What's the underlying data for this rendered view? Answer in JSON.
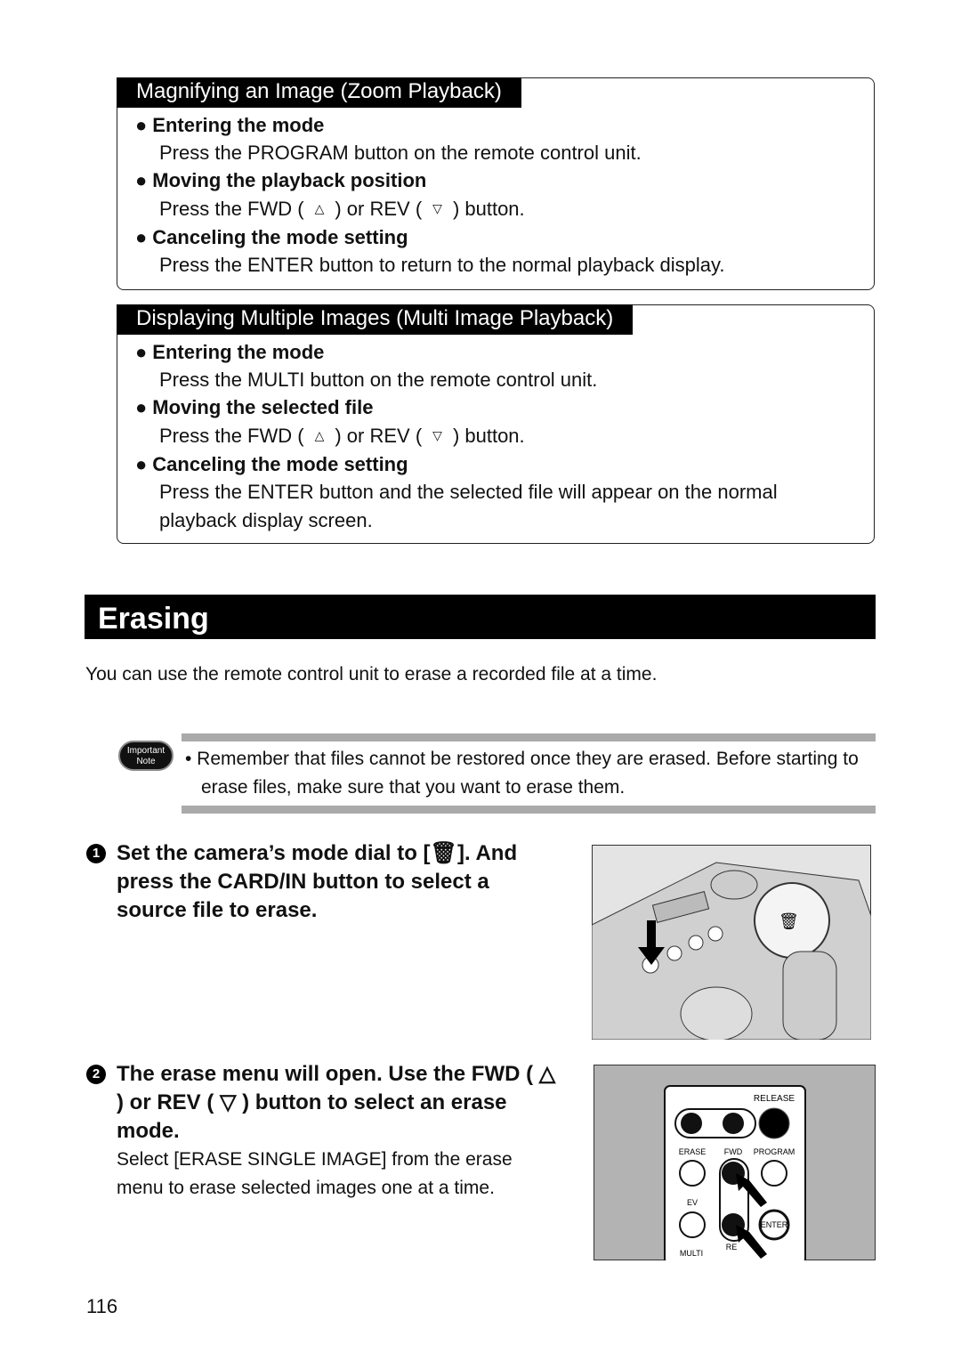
{
  "zoom_box": {
    "title": "Magnifying an Image (Zoom Playback)",
    "items": [
      {
        "heading": "Entering the mode",
        "body": "Press the PROGRAM button on the remote control unit."
      },
      {
        "heading": "Moving the playback position",
        "body_pre": "Press the FWD (",
        "fwd_symbol": "△",
        "body_mid": ") or REV (",
        "rev_symbol": "▽",
        "body_post": ") button."
      },
      {
        "heading": "Canceling the mode setting",
        "body": "Press the ENTER button to return to the normal playback display."
      }
    ]
  },
  "multi_box": {
    "title": "Displaying Multiple Images (Multi Image Playback)",
    "items": [
      {
        "heading": "Entering the mode",
        "body": "Press the MULTI button on the remote control unit."
      },
      {
        "heading": "Moving the selected file",
        "body_pre": "Press the FWD (",
        "fwd_symbol": "△",
        "body_mid": ") or REV (",
        "rev_symbol": "▽",
        "body_post": ") button."
      },
      {
        "heading": "Canceling the mode setting",
        "body": "Press the ENTER button and the selected file will appear on the normal playback display screen."
      }
    ]
  },
  "section_title": "Erasing",
  "intro": "You can use the remote control unit to erase a recorded file at a time.",
  "note": {
    "badge_line1": "Important",
    "badge_line2": "Note",
    "text": "• Remember that files cannot be restored once they are erased.  Before starting to erase files, make sure that you want to erase them."
  },
  "steps": [
    {
      "number": "1",
      "text": "Set the camera’s mode dial to [🗑]. And press the CARD/IN button to select a source file to erase."
    },
    {
      "number": "2",
      "text": "The erase menu will open.  Use the FWD ( △ ) or REV ( ▽ ) button to select an erase mode.",
      "detail": "Select [ERASE SINGLE IMAGE] from the erase menu to erase selected images one at a time."
    }
  ],
  "remote": {
    "release": "RELEASE",
    "erase": "ERASE",
    "fwd": "FWD",
    "program": "PROGRAM",
    "ev": "EV",
    "enter": "ENTER",
    "rev": "RE",
    "multi": "MULTI"
  },
  "page_number": "116"
}
